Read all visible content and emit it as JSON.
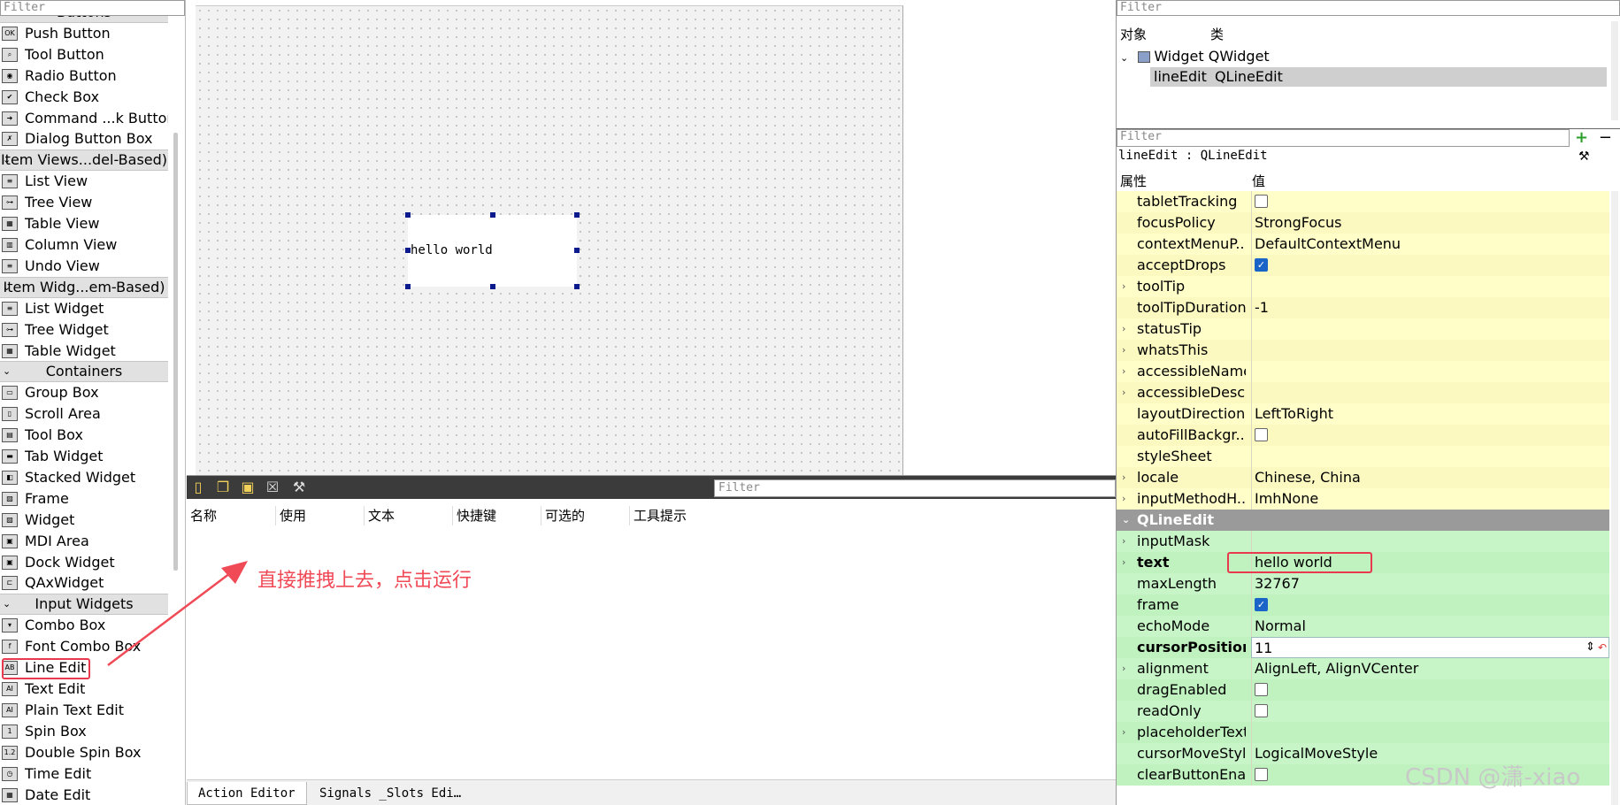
{
  "widget_box": {
    "filter_placeholder": "Filter",
    "sections": [
      {
        "type": "category",
        "label": "Buttons"
      },
      {
        "type": "item",
        "label": "Push Button",
        "icon": "push-button-icon",
        "glyph": "OK"
      },
      {
        "type": "item",
        "label": "Tool Button",
        "icon": "tool-button-icon",
        "glyph": "⌕"
      },
      {
        "type": "item",
        "label": "Radio Button",
        "icon": "radio-button-icon",
        "glyph": "◉"
      },
      {
        "type": "item",
        "label": "Check Box",
        "icon": "check-box-icon",
        "glyph": "✔"
      },
      {
        "type": "item",
        "label": "Command ...k Button",
        "icon": "command-link-icon",
        "glyph": "➜"
      },
      {
        "type": "item",
        "label": "Dialog Button Box",
        "icon": "dialog-button-box-icon",
        "glyph": "✗"
      },
      {
        "type": "category",
        "label": "Item Views...del-Based)"
      },
      {
        "type": "item",
        "label": "List View",
        "icon": "list-view-icon",
        "glyph": "≡"
      },
      {
        "type": "item",
        "label": "Tree View",
        "icon": "tree-view-icon",
        "glyph": "⊶"
      },
      {
        "type": "item",
        "label": "Table View",
        "icon": "table-view-icon",
        "glyph": "▦"
      },
      {
        "type": "item",
        "label": "Column View",
        "icon": "column-view-icon",
        "glyph": "▥"
      },
      {
        "type": "item",
        "label": "Undo View",
        "icon": "undo-view-icon",
        "glyph": "≡"
      },
      {
        "type": "category",
        "label": "Item Widg...em-Based)"
      },
      {
        "type": "item",
        "label": "List Widget",
        "icon": "list-widget-icon",
        "glyph": "≡"
      },
      {
        "type": "item",
        "label": "Tree Widget",
        "icon": "tree-widget-icon",
        "glyph": "⊶"
      },
      {
        "type": "item",
        "label": "Table Widget",
        "icon": "table-widget-icon",
        "glyph": "▦"
      },
      {
        "type": "category",
        "label": "Containers"
      },
      {
        "type": "item",
        "label": "Group Box",
        "icon": "group-box-icon",
        "glyph": "▭"
      },
      {
        "type": "item",
        "label": "Scroll Area",
        "icon": "scroll-area-icon",
        "glyph": "▯"
      },
      {
        "type": "item",
        "label": "Tool Box",
        "icon": "tool-box-icon",
        "glyph": "▤"
      },
      {
        "type": "item",
        "label": "Tab Widget",
        "icon": "tab-widget-icon",
        "glyph": "▬"
      },
      {
        "type": "item",
        "label": "Stacked Widget",
        "icon": "stacked-widget-icon",
        "glyph": "◧"
      },
      {
        "type": "item",
        "label": "Frame",
        "icon": "frame-icon",
        "glyph": "▨"
      },
      {
        "type": "item",
        "label": "Widget",
        "icon": "widget-icon",
        "glyph": "▨"
      },
      {
        "type": "item",
        "label": "MDI Area",
        "icon": "mdi-area-icon",
        "glyph": "▣"
      },
      {
        "type": "item",
        "label": "Dock Widget",
        "icon": "dock-widget-icon",
        "glyph": "▣"
      },
      {
        "type": "item",
        "label": "QAxWidget",
        "icon": "qaxwidget-icon",
        "glyph": "⊏"
      },
      {
        "type": "category",
        "label": "Input Widgets"
      },
      {
        "type": "item",
        "label": "Combo Box",
        "icon": "combo-box-icon",
        "glyph": "▾"
      },
      {
        "type": "item",
        "label": "Font Combo Box",
        "icon": "font-combo-box-icon",
        "glyph": "f"
      },
      {
        "type": "item",
        "label": "Line Edit",
        "icon": "line-edit-icon",
        "glyph": "AB"
      },
      {
        "type": "item",
        "label": "Text Edit",
        "icon": "text-edit-icon",
        "glyph": "AI"
      },
      {
        "type": "item",
        "label": "Plain Text Edit",
        "icon": "plain-text-edit-icon",
        "glyph": "AI"
      },
      {
        "type": "item",
        "label": "Spin Box",
        "icon": "spin-box-icon",
        "glyph": "1"
      },
      {
        "type": "item",
        "label": "Double Spin Box",
        "icon": "double-spin-box-icon",
        "glyph": "1.2"
      },
      {
        "type": "item",
        "label": "Time Edit",
        "icon": "time-edit-icon",
        "glyph": "◷"
      },
      {
        "type": "item",
        "label": "Date Edit",
        "icon": "date-edit-icon",
        "glyph": "▦"
      }
    ]
  },
  "form": {
    "line_edit_text": "hello world"
  },
  "action_editor": {
    "filter_placeholder": "Filter",
    "columns": [
      "名称",
      "使用",
      "文本",
      "快捷键",
      "可选的",
      "工具提示"
    ],
    "annotation": "直接推拽上去，点击运行",
    "tabs": [
      "Action Editor",
      "Signals _Slots Edi…"
    ]
  },
  "object_inspector": {
    "filter_placeholder": "Filter",
    "columns": [
      "对象",
      "类"
    ],
    "rows": [
      {
        "object": "Widget",
        "class": "QWidget"
      },
      {
        "object": "lineEdit",
        "class": "QLineEdit"
      }
    ]
  },
  "property_editor": {
    "filter_placeholder": "Filter",
    "class_label": "lineEdit : QLineEdit",
    "columns": [
      "属性",
      "值"
    ],
    "rows": [
      {
        "name": "tabletTracking",
        "kind": "check",
        "checked": false,
        "group": "QWidget"
      },
      {
        "name": "focusPolicy",
        "value": "StrongFocus",
        "group": "QWidget"
      },
      {
        "name": "contextMenuP...",
        "value": "DefaultContextMenu",
        "group": "QWidget"
      },
      {
        "name": "acceptDrops",
        "kind": "check",
        "checked": true,
        "group": "QWidget"
      },
      {
        "name": "toolTip",
        "value": "",
        "expandable": true,
        "group": "QWidget"
      },
      {
        "name": "toolTipDuration",
        "value": "-1",
        "group": "QWidget"
      },
      {
        "name": "statusTip",
        "value": "",
        "expandable": true,
        "group": "QWidget"
      },
      {
        "name": "whatsThis",
        "value": "",
        "expandable": true,
        "group": "QWidget"
      },
      {
        "name": "accessibleName",
        "value": "",
        "expandable": true,
        "group": "QWidget"
      },
      {
        "name": "accessibleDesc...",
        "value": "",
        "expandable": true,
        "group": "QWidget"
      },
      {
        "name": "layoutDirection",
        "value": "LeftToRight",
        "group": "QWidget"
      },
      {
        "name": "autoFillBackgr...",
        "kind": "check",
        "checked": false,
        "group": "QWidget"
      },
      {
        "name": "styleSheet",
        "value": "",
        "group": "QWidget"
      },
      {
        "name": "locale",
        "value": "Chinese, China",
        "expandable": true,
        "group": "QWidget"
      },
      {
        "name": "inputMethodH...",
        "value": "ImhNone",
        "expandable": true,
        "group": "QWidget"
      },
      {
        "name": "QLineEdit",
        "kind": "group"
      },
      {
        "name": "inputMask",
        "value": "",
        "expandable": true,
        "group": "QLineEdit"
      },
      {
        "name": "text",
        "value": "hello world",
        "expandable": true,
        "bold": true,
        "group": "QLineEdit"
      },
      {
        "name": "maxLength",
        "value": "32767",
        "group": "QLineEdit"
      },
      {
        "name": "frame",
        "kind": "check",
        "checked": true,
        "group": "QLineEdit"
      },
      {
        "name": "echoMode",
        "value": "Normal",
        "group": "QLineEdit"
      },
      {
        "name": "cursorPosition",
        "value": "11",
        "bold": true,
        "editing": true,
        "group": "QLineEdit"
      },
      {
        "name": "alignment",
        "value": "AlignLeft, AlignVCenter",
        "expandable": true,
        "group": "QLineEdit"
      },
      {
        "name": "dragEnabled",
        "kind": "check",
        "checked": false,
        "group": "QLineEdit"
      },
      {
        "name": "readOnly",
        "kind": "check",
        "checked": false,
        "group": "QLineEdit"
      },
      {
        "name": "placeholderText",
        "value": "",
        "expandable": true,
        "group": "QLineEdit"
      },
      {
        "name": "cursorMoveStyle",
        "value": "LogicalMoveStyle",
        "group": "QLineEdit"
      },
      {
        "name": "clearButtonEna...",
        "kind": "check",
        "checked": false,
        "group": "QLineEdit"
      }
    ]
  },
  "watermark": "CSDN @潇-xiao",
  "colors": {
    "highlight": "#e8394f",
    "annotation": "#f04a57",
    "qwidget_rows": "#fffdc8",
    "qlineedit_rows": "#c8f5c8"
  }
}
